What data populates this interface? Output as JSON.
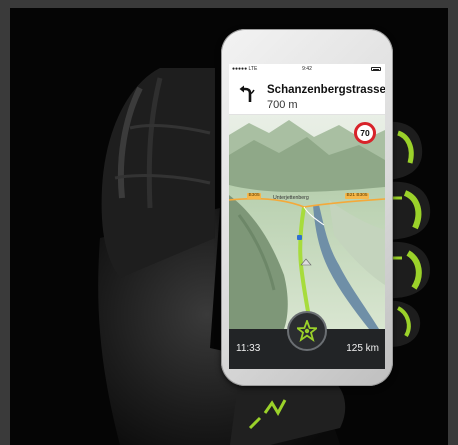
{
  "status_bar": {
    "carrier": "●●●●● LTE",
    "time": "9:42"
  },
  "navigation": {
    "street": "Schanzenbergstrasse",
    "distance": "700 m",
    "turn_icon": "turn-left-arrow-icon"
  },
  "speed_limit": {
    "value": "70",
    "color": "#d8232a"
  },
  "map_labels": {
    "town": "Unterjettenberg",
    "road_left": "B305",
    "road_right": "B21 B305"
  },
  "bottom_bar": {
    "clock": "11:33",
    "remaining_distance": "125 km",
    "center_icon": "star-navigation-icon",
    "page_dots": 3,
    "active_dot": 1
  },
  "colors": {
    "accent": "#9bd22a",
    "route": "#a7dc3c",
    "water": "#6f8fa7",
    "glove": "#1b1b1b"
  }
}
